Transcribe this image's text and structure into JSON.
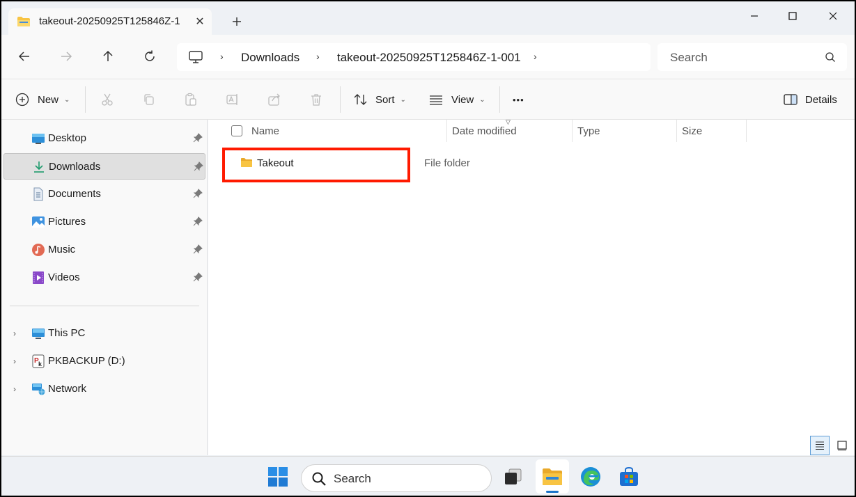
{
  "window": {
    "tab_title": "takeout-20250925T125846Z-1",
    "new_tab_symbol": "+",
    "close_tab_symbol": "✕"
  },
  "address": {
    "breadcrumbs": [
      "Downloads",
      "takeout-20250925T125846Z-1-001"
    ],
    "separator": "›"
  },
  "search": {
    "placeholder": "Search"
  },
  "commands": {
    "new_label": "New",
    "sort_label": "Sort",
    "view_label": "View",
    "more_label": "•••",
    "details_label": "Details"
  },
  "sidebar": {
    "quick_access": [
      {
        "label": "Desktop",
        "icon": "desktop-icon",
        "pinned": true
      },
      {
        "label": "Downloads",
        "icon": "downloads-icon",
        "pinned": true,
        "selected": true
      },
      {
        "label": "Documents",
        "icon": "documents-icon",
        "pinned": true
      },
      {
        "label": "Pictures",
        "icon": "pictures-icon",
        "pinned": true
      },
      {
        "label": "Music",
        "icon": "music-icon",
        "pinned": true
      },
      {
        "label": "Videos",
        "icon": "videos-icon",
        "pinned": true
      }
    ],
    "locations": [
      {
        "label": "This PC",
        "icon": "this-pc-icon"
      },
      {
        "label": "PKBACKUP (D:)",
        "icon": "drive-icon"
      },
      {
        "label": "Network",
        "icon": "network-icon"
      }
    ]
  },
  "filelist": {
    "columns": [
      "Name",
      "Date modified",
      "Type",
      "Size"
    ],
    "rows": [
      {
        "name": "Takeout",
        "date_modified": "",
        "type": "File folder",
        "size": ""
      }
    ]
  },
  "taskbar": {
    "search_label": "Search",
    "apps": [
      "start-icon",
      "task-view-icon",
      "file-explorer-icon",
      "edge-icon",
      "store-icon"
    ]
  },
  "colors": {
    "highlight": "#ff1a00",
    "accent": "#1a73c8",
    "folder": "#f8c443"
  }
}
